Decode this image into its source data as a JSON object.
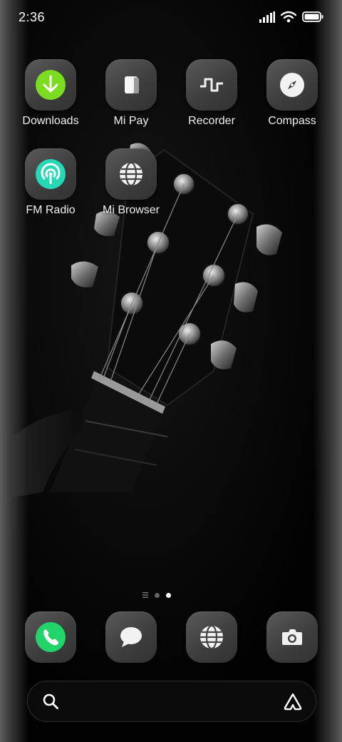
{
  "status_bar": {
    "time": "2:36",
    "icons": [
      "signal-icon",
      "wifi-icon",
      "battery-icon"
    ]
  },
  "home_apps": [
    {
      "label": "Downloads",
      "icon": "download-icon",
      "accent": "#7bdc22"
    },
    {
      "label": "Mi Pay",
      "icon": "card-icon"
    },
    {
      "label": "Recorder",
      "icon": "waveform-icon"
    },
    {
      "label": "Compass",
      "icon": "compass-icon"
    },
    {
      "label": "FM Radio",
      "icon": "radio-icon",
      "accent": "#25d9b4"
    },
    {
      "label": "Mi Browser",
      "icon": "globe-icon"
    }
  ],
  "page_indicator": {
    "pages": 2,
    "current": 2,
    "has_menu_marker": true
  },
  "dock": [
    {
      "icon": "phone-icon",
      "accent": "#22d46a"
    },
    {
      "icon": "message-icon"
    },
    {
      "icon": "browser-globe-icon"
    },
    {
      "icon": "camera-icon"
    }
  ],
  "search": {
    "icon": "search-icon",
    "assistant_icon": "assistant-a-icon"
  },
  "colors": {
    "background": "#050505",
    "tile": "#444444",
    "label": "#f2f2f2"
  }
}
